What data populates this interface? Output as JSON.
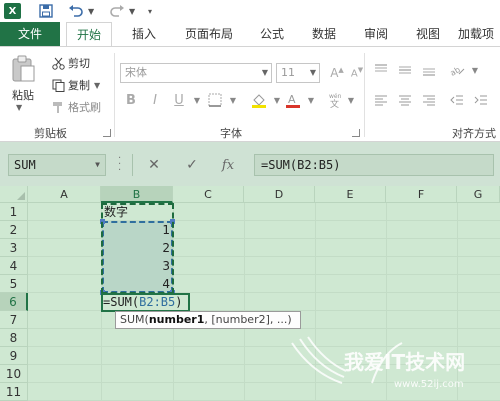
{
  "qat": {
    "app_icon": "X"
  },
  "tabs": [
    {
      "label": "文件"
    },
    {
      "label": "开始"
    },
    {
      "label": "插入"
    },
    {
      "label": "页面布局"
    },
    {
      "label": "公式"
    },
    {
      "label": "数据"
    },
    {
      "label": "审阅"
    },
    {
      "label": "视图"
    },
    {
      "label": "加载项"
    }
  ],
  "ribbon": {
    "clipboard": {
      "paste": "粘贴",
      "cut": "剪切",
      "copy": "复制",
      "format_painter": "格式刷",
      "label": "剪贴板"
    },
    "font": {
      "font_name": "宋体",
      "font_size": "11",
      "bold": "B",
      "italic": "I",
      "underline": "U",
      "label": "字体"
    },
    "alignment": {
      "label": "对齐方式"
    }
  },
  "formula_bar": {
    "name_box": "SUM",
    "cancel": "✕",
    "enter": "✓",
    "fx": "fx",
    "formula": "=SUM(B2:B5)"
  },
  "columns": [
    "A",
    "B",
    "C",
    "D",
    "E",
    "F",
    "G"
  ],
  "rows": [
    "1",
    "2",
    "3",
    "4",
    "5",
    "6",
    "7",
    "8",
    "9",
    "10",
    "11"
  ],
  "cells": {
    "B1": "数字",
    "B2": "1",
    "B3": "2",
    "B4": "3",
    "B5": "4",
    "B6_prefix": "=SUM(",
    "B6_ref": "B2:B5",
    "B6_suffix": ")"
  },
  "tooltip": {
    "fn": "SUM(",
    "arg1": "number1",
    "rest": ", [number2], ...)"
  },
  "colors": {
    "excel_green": "#217346",
    "grid_bg": "#cfe8d2",
    "ref_blue": "#2f6e9e"
  }
}
